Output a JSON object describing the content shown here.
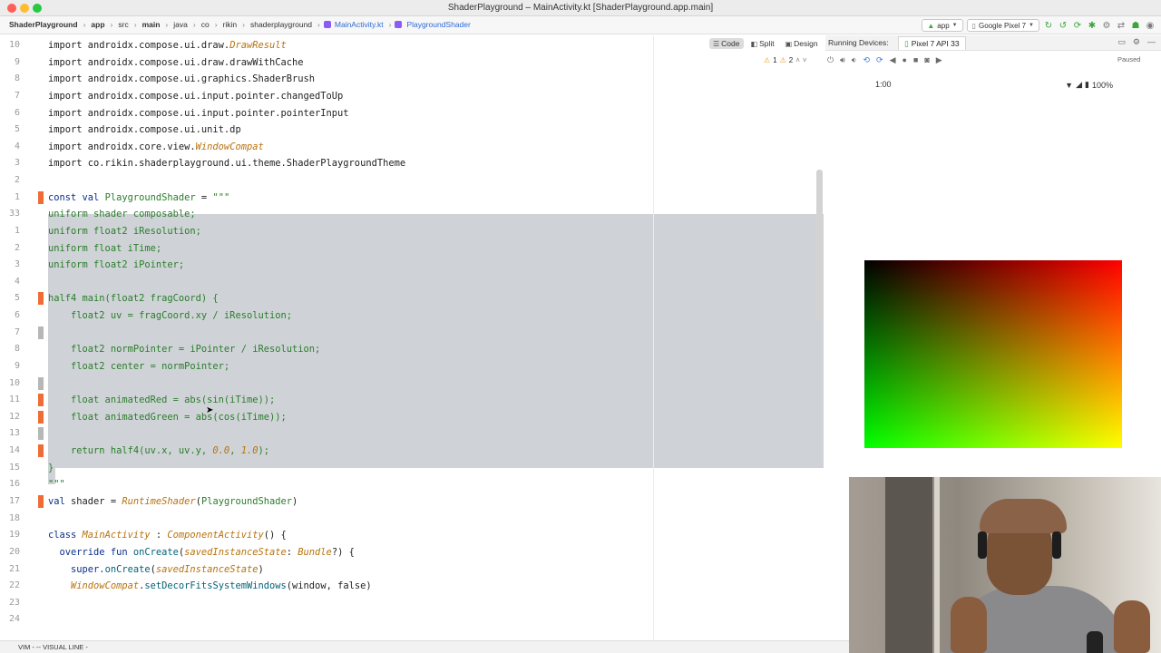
{
  "window": {
    "title": "ShaderPlayground – MainActivity.kt [ShaderPlayground.app.main]"
  },
  "breadcrumbs": [
    "ShaderPlayground",
    "app",
    "src",
    "main",
    "java",
    "co",
    "rikin",
    "shaderplayground",
    "MainActivity.kt",
    "PlaygroundShader"
  ],
  "toolbar": {
    "run_config": "app",
    "device": "Google Pixel 7"
  },
  "view_modes": {
    "code": "Code",
    "split": "Split",
    "design": "Design"
  },
  "running_devices": {
    "label": "Running Devices:",
    "tab": "Pixel 7 API 33",
    "state": "Paused"
  },
  "inspections": {
    "warnings": "1",
    "weak_warnings": "2"
  },
  "device_screen": {
    "time": "1:00",
    "battery": "100%"
  },
  "editor": {
    "lines": [
      {
        "num": "10",
        "segments": [
          {
            "t": "import androidx.compose.ui.draw.",
            "c": ""
          },
          {
            "t": "DrawResult",
            "c": "ital"
          }
        ]
      },
      {
        "num": "9",
        "segments": [
          {
            "t": "import androidx.compose.ui.draw.drawWithCache",
            "c": ""
          }
        ]
      },
      {
        "num": "8",
        "segments": [
          {
            "t": "import androidx.compose.ui.graphics.ShaderBrush",
            "c": ""
          }
        ]
      },
      {
        "num": "7",
        "segments": [
          {
            "t": "import androidx.compose.ui.input.pointer.changedToUp",
            "c": ""
          }
        ]
      },
      {
        "num": "6",
        "segments": [
          {
            "t": "import androidx.compose.ui.input.pointer.pointerInput",
            "c": ""
          }
        ]
      },
      {
        "num": "5",
        "segments": [
          {
            "t": "import androidx.compose.ui.unit.dp",
            "c": ""
          }
        ]
      },
      {
        "num": "4",
        "segments": [
          {
            "t": "import androidx.core.view.",
            "c": ""
          },
          {
            "t": "WindowCompat",
            "c": "ital"
          }
        ]
      },
      {
        "num": "3",
        "segments": [
          {
            "t": "import co.rikin.shaderplayground.ui.theme.ShaderPlaygroundTheme",
            "c": ""
          }
        ]
      },
      {
        "num": "2",
        "segments": [
          {
            "t": "",
            "c": ""
          }
        ]
      },
      {
        "num": "1",
        "segments": [
          {
            "t": "const val ",
            "c": "kw"
          },
          {
            "t": "PlaygroundShader",
            "c": "str"
          },
          {
            "t": " = ",
            "c": ""
          },
          {
            "t": "\"\"\"",
            "c": "str"
          }
        ]
      },
      {
        "num": "33",
        "segments": [
          {
            "t": "uniform shader composable;",
            "c": "str"
          }
        ]
      },
      {
        "num": "1",
        "segments": [
          {
            "t": "uniform float2 iResolution;",
            "c": "str"
          }
        ]
      },
      {
        "num": "2",
        "segments": [
          {
            "t": "uniform float iTime;",
            "c": "str"
          }
        ]
      },
      {
        "num": "3",
        "segments": [
          {
            "t": "uniform float2 iPointer;",
            "c": "str"
          }
        ]
      },
      {
        "num": "4",
        "segments": [
          {
            "t": "",
            "c": ""
          }
        ]
      },
      {
        "num": "5",
        "segments": [
          {
            "t": "half4 main(float2 fragCoord) {",
            "c": "str"
          }
        ]
      },
      {
        "num": "6",
        "segments": [
          {
            "t": "    float2 uv = fragCoord.xy / iResolution;",
            "c": "str"
          }
        ]
      },
      {
        "num": "7",
        "segments": [
          {
            "t": "",
            "c": ""
          }
        ]
      },
      {
        "num": "8",
        "segments": [
          {
            "t": "    float2 normPointer = iPointer / iResolution;",
            "c": "str"
          }
        ]
      },
      {
        "num": "9",
        "segments": [
          {
            "t": "    float2 center = normPointer;",
            "c": "str"
          }
        ]
      },
      {
        "num": "10",
        "segments": [
          {
            "t": "",
            "c": ""
          }
        ]
      },
      {
        "num": "11",
        "segments": [
          {
            "t": "    float animatedRed = abs(sin(iTime));",
            "c": "str"
          }
        ]
      },
      {
        "num": "12",
        "segments": [
          {
            "t": "    float animatedGreen = abs(cos(iTime));",
            "c": "str"
          }
        ]
      },
      {
        "num": "13",
        "segments": [
          {
            "t": "",
            "c": ""
          }
        ]
      },
      {
        "num": "14",
        "segments": [
          {
            "t": "    return half4(uv.x, uv.y, ",
            "c": "str"
          },
          {
            "t": "0.0",
            "c": "ital"
          },
          {
            "t": ", ",
            "c": "str"
          },
          {
            "t": "1.0",
            "c": "ital"
          },
          {
            "t": ");",
            "c": "str"
          }
        ]
      },
      {
        "num": "15",
        "segments": [
          {
            "t": "}",
            "c": "str"
          }
        ]
      },
      {
        "num": "16",
        "segments": [
          {
            "t": "\"\"\"",
            "c": "str"
          }
        ]
      },
      {
        "num": "17",
        "segments": [
          {
            "t": "val ",
            "c": "kw"
          },
          {
            "t": "shader",
            "c": ""
          },
          {
            "t": " = ",
            "c": ""
          },
          {
            "t": "RuntimeShader",
            "c": "ital"
          },
          {
            "t": "(",
            "c": ""
          },
          {
            "t": "PlaygroundShader",
            "c": "str"
          },
          {
            "t": ")",
            "c": ""
          }
        ]
      },
      {
        "num": "18",
        "segments": [
          {
            "t": "",
            "c": ""
          }
        ]
      },
      {
        "num": "19",
        "segments": [
          {
            "t": "class ",
            "c": "kw"
          },
          {
            "t": "MainActivity",
            "c": "ital"
          },
          {
            "t": " : ",
            "c": ""
          },
          {
            "t": "ComponentActivity",
            "c": "ital"
          },
          {
            "t": "() {",
            "c": ""
          }
        ]
      },
      {
        "num": "20",
        "segments": [
          {
            "t": "  override fun ",
            "c": "kw"
          },
          {
            "t": "onCreate",
            "c": "fn"
          },
          {
            "t": "(",
            "c": ""
          },
          {
            "t": "savedInstanceState",
            "c": "ital"
          },
          {
            "t": ": ",
            "c": ""
          },
          {
            "t": "Bundle",
            "c": "ital"
          },
          {
            "t": "?) {",
            "c": ""
          }
        ]
      },
      {
        "num": "21",
        "segments": [
          {
            "t": "    super.",
            "c": "kw"
          },
          {
            "t": "onCreate",
            "c": "fn"
          },
          {
            "t": "(",
            "c": ""
          },
          {
            "t": "savedInstanceState",
            "c": "ital"
          },
          {
            "t": ")",
            "c": ""
          }
        ]
      },
      {
        "num": "22",
        "segments": [
          {
            "t": "    ",
            "c": ""
          },
          {
            "t": "WindowCompat",
            "c": "ital"
          },
          {
            "t": ".",
            "c": ""
          },
          {
            "t": "setDecorFitsSystemWindows",
            "c": "fn"
          },
          {
            "t": "(window, false)",
            "c": ""
          }
        ]
      },
      {
        "num": "23",
        "segments": [
          {
            "t": "",
            "c": ""
          }
        ]
      },
      {
        "num": "24",
        "segments": [
          {
            "t": "",
            "c": ""
          }
        ]
      }
    ]
  },
  "status_bar": {
    "mode": "VIM - -- VISUAL LINE -"
  }
}
